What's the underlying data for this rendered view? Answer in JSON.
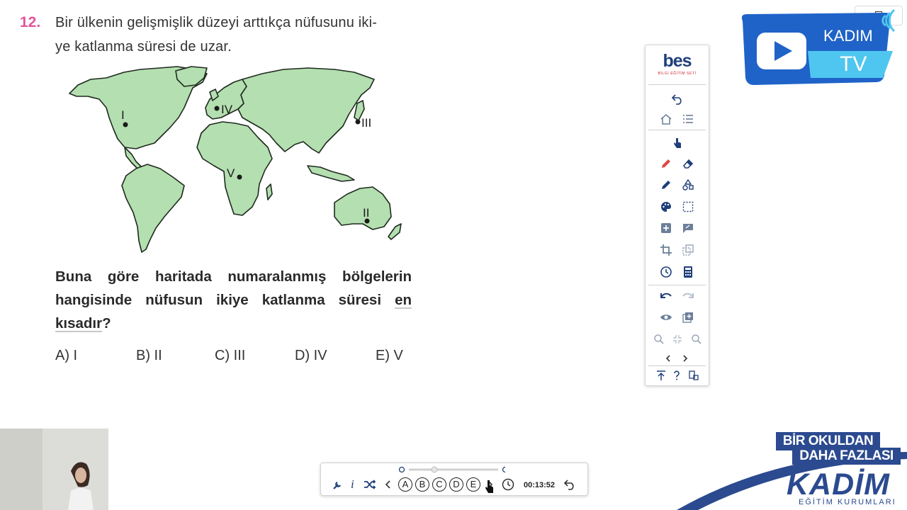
{
  "question": {
    "number": "12.",
    "stem_line1": "Bir ülkenin gelişmişlik düzeyi arttıkça nüfusunu iki-",
    "stem_line2": "ye katlanma süresi de uzar.",
    "bold_line1": "Buna göre haritada numaralanmış bölgelerin",
    "bold_line2_a": "hangisinde nüfusun ikiye katlanma süresi ",
    "bold_line2_b": "en",
    "bold_line3_a": "kısadır",
    "bold_line3_b": "?",
    "choices": [
      "A) I",
      "B) II",
      "C) III",
      "D) IV",
      "E) V"
    ]
  },
  "map": {
    "labels": [
      "I",
      "II",
      "III",
      "IV",
      "V"
    ]
  },
  "toolbar": {
    "logo_text": "bes",
    "logo_subtitle": "BİLGİ EĞİTİM SETİ"
  },
  "tv_badge": {
    "brand": "KADIM",
    "tv": "TV"
  },
  "bottom_bar": {
    "answer_options": [
      "A",
      "B",
      "C",
      "D",
      "E"
    ],
    "timer": "00:13:52"
  },
  "branding": {
    "line1": "BİR OKULDAN",
    "line2": "DAHA FAZLASI",
    "logo": "KADİM",
    "tagline": "EĞİTİM KURUMLARI"
  },
  "colors": {
    "question_number": "#e2559a",
    "land": "#b4dfb0",
    "brand_blue": "#2b4a8f",
    "tv_blue": "#1f63c8",
    "tv_cyan": "#4fc6f0"
  }
}
